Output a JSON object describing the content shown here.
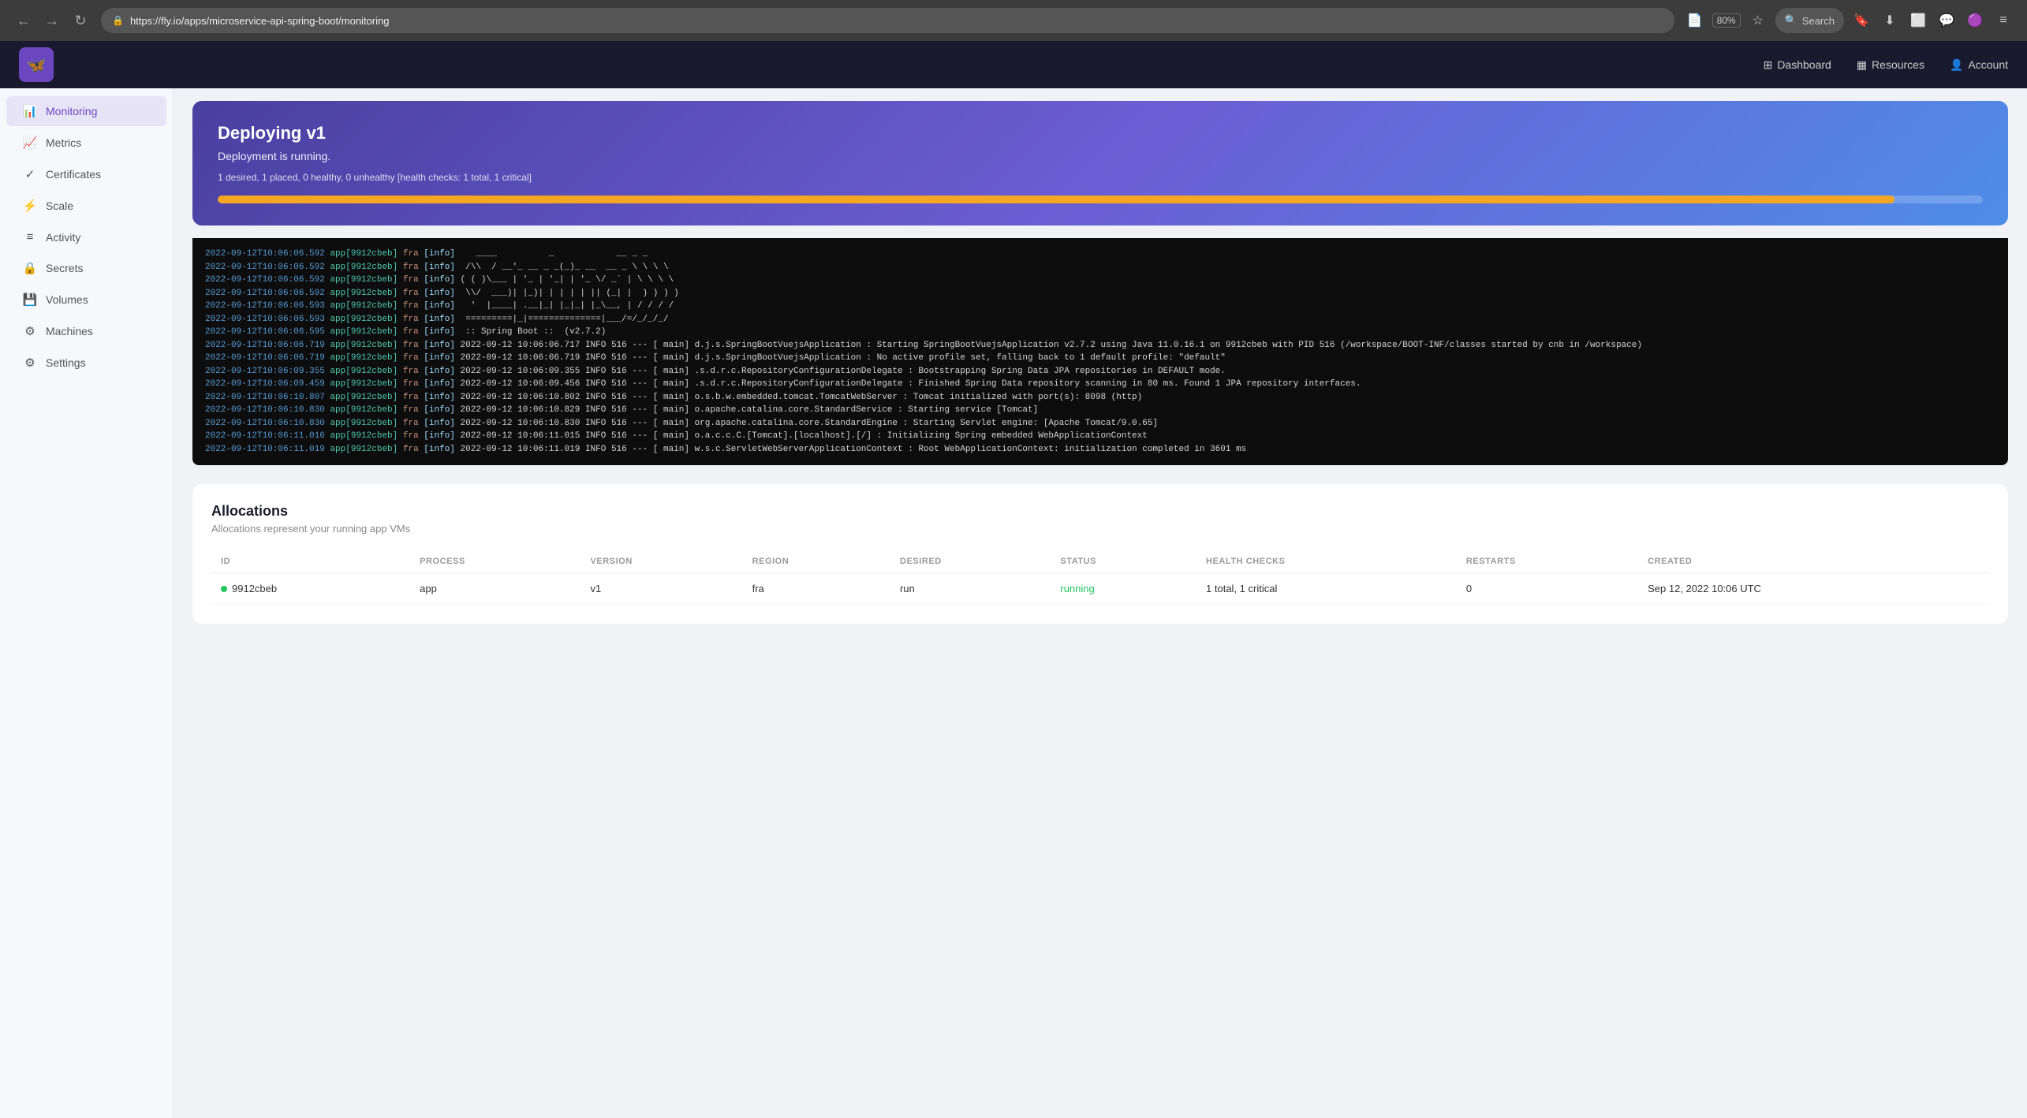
{
  "browser": {
    "url": "https://fly.io/apps/microservice-api-spring-boot/monitoring",
    "zoom": "80%",
    "search_placeholder": "Search"
  },
  "header": {
    "nav": [
      {
        "id": "dashboard",
        "label": "Dashboard",
        "icon": "⊞"
      },
      {
        "id": "resources",
        "label": "Resources",
        "icon": "▦"
      },
      {
        "id": "account",
        "label": "Account",
        "icon": "👤"
      }
    ]
  },
  "sidebar": {
    "items": [
      {
        "id": "monitoring",
        "label": "Monitoring",
        "icon": "📊",
        "active": true
      },
      {
        "id": "metrics",
        "label": "Metrics",
        "icon": "📈"
      },
      {
        "id": "certificates",
        "label": "Certificates",
        "icon": "✓"
      },
      {
        "id": "scale",
        "label": "Scale",
        "icon": "⚡"
      },
      {
        "id": "activity",
        "label": "Activity",
        "icon": "≡"
      },
      {
        "id": "secrets",
        "label": "Secrets",
        "icon": "🔒"
      },
      {
        "id": "volumes",
        "label": "Volumes",
        "icon": "💾"
      },
      {
        "id": "machines",
        "label": "Machines",
        "icon": "⚙"
      },
      {
        "id": "settings",
        "label": "Settings",
        "icon": "⚙"
      }
    ]
  },
  "deployment": {
    "title": "Deploying v1",
    "status": "Deployment is running.",
    "info": "1 desired, 1 placed, 0 healthy, 0 unhealthy [health checks: 1 total, 1 critical]",
    "progress": 95
  },
  "logs": [
    {
      "timestamp": "2022-09-12T10:06:06.592",
      "app": "app[9912cbeb]",
      "region": "fra",
      "level": "[info]",
      "text": "   ____          _            __ _ _"
    },
    {
      "timestamp": "2022-09-12T10:06:06.592",
      "app": "app[9912cbeb]",
      "region": "fra",
      "level": "[info]",
      "text": " /\\\\  / __'_ __ _ _(_)_ __  __ _ \\ \\ \\ \\"
    },
    {
      "timestamp": "2022-09-12T10:06:06.592",
      "app": "app[9912cbeb]",
      "region": "fra",
      "level": "[info]",
      "text": "( ( )\\___ | '_ | '_| | '_ \\/ _` | \\ \\ \\ \\"
    },
    {
      "timestamp": "2022-09-12T10:06:06.592",
      "app": "app[9912cbeb]",
      "region": "fra",
      "level": "[info]",
      "text": " \\\\/  ___)| |_)| | | | | || (_| |  ) ) ) )"
    },
    {
      "timestamp": "2022-09-12T10:06:06.593",
      "app": "app[9912cbeb]",
      "region": "fra",
      "level": "[info]",
      "text": "  '  |____| .__|_| |_|_| |_\\__, | / / / /"
    },
    {
      "timestamp": "2022-09-12T10:06:06.593",
      "app": "app[9912cbeb]",
      "region": "fra",
      "level": "[info]",
      "text": " =========|_|==============|___/=/_/_/_/"
    },
    {
      "timestamp": "2022-09-12T10:06:06.595",
      "app": "app[9912cbeb]",
      "region": "fra",
      "level": "[info]",
      "text": " :: Spring Boot ::  (v2.7.2)"
    },
    {
      "timestamp": "2022-09-12T10:06:06.719",
      "app": "app[9912cbeb]",
      "region": "fra",
      "level": "[info]",
      "text": "2022-09-12 10:06:06.717 INFO 516 --- [ main] d.j.s.SpringBootVuejsApplication : Starting SpringBootVuejsApplication v2.7.2 using Java 11.0.16.1 on 9912cbeb with PID 516 (/workspace/BOOT-INF/classes started by cnb in /workspace)"
    },
    {
      "timestamp": "2022-09-12T10:06:06.719",
      "app": "app[9912cbeb]",
      "region": "fra",
      "level": "[info]",
      "text": "2022-09-12 10:06:06.719 INFO 516 --- [ main] d.j.s.SpringBootVuejsApplication : No active profile set, falling back to 1 default profile: \"default\""
    },
    {
      "timestamp": "2022-09-12T10:06:09.355",
      "app": "app[9912cbeb]",
      "region": "fra",
      "level": "[info]",
      "text": "2022-09-12 10:06:09.355 INFO 516 --- [ main] .s.d.r.c.RepositoryConfigurationDelegate : Bootstrapping Spring Data JPA repositories in DEFAULT mode."
    },
    {
      "timestamp": "2022-09-12T10:06:09.459",
      "app": "app[9912cbeb]",
      "region": "fra",
      "level": "[info]",
      "text": "2022-09-12 10:06:09.456 INFO 516 --- [ main] .s.d.r.c.RepositoryConfigurationDelegate : Finished Spring Data repository scanning in 80 ms. Found 1 JPA repository interfaces."
    },
    {
      "timestamp": "2022-09-12T10:06:10.807",
      "app": "app[9912cbeb]",
      "region": "fra",
      "level": "[info]",
      "text": "2022-09-12 10:06:10.802 INFO 516 --- [ main] o.s.b.w.embedded.tomcat.TomcatWebServer : Tomcat initialized with port(s): 8098 (http)"
    },
    {
      "timestamp": "2022-09-12T10:06:10.830",
      "app": "app[9912cbeb]",
      "region": "fra",
      "level": "[info]",
      "text": "2022-09-12 10:06:10.829 INFO 516 --- [ main] o.apache.catalina.core.StandardService : Starting service [Tomcat]"
    },
    {
      "timestamp": "2022-09-12T10:06:10.830",
      "app": "app[9912cbeb]",
      "region": "fra",
      "level": "[info]",
      "text": "2022-09-12 10:06:10.830 INFO 516 --- [ main] org.apache.catalina.core.StandardEngine : Starting Servlet engine: [Apache Tomcat/9.0.65]"
    },
    {
      "timestamp": "2022-09-12T10:06:11.016",
      "app": "app[9912cbeb]",
      "region": "fra",
      "level": "[info]",
      "text": "2022-09-12 10:06:11.015 INFO 516 --- [ main] o.a.c.c.C.[Tomcat].[localhost].[/] : Initializing Spring embedded WebApplicationContext"
    },
    {
      "timestamp": "2022-09-12T10:06:11.019",
      "app": "app[9912cbeb]",
      "region": "fra",
      "level": "[info]",
      "text": "2022-09-12 10:06:11.019 INFO 516 --- [ main] w.s.c.ServletWebServerApplicationContext : Root WebApplicationContext: initialization completed in 3601 ms"
    }
  ],
  "allocations": {
    "title": "Allocations",
    "description": "Allocations represent your running app VMs",
    "columns": [
      "ID",
      "PROCESS",
      "VERSION",
      "REGION",
      "DESIRED",
      "STATUS",
      "HEALTH CHECKS",
      "RESTARTS",
      "CREATED"
    ],
    "rows": [
      {
        "id": "9912cbeb",
        "process": "app",
        "version": "v1",
        "region": "fra",
        "desired": "run",
        "status": "running",
        "health_checks": "1 total, 1 critical",
        "restarts": "0",
        "created": "Sep 12, 2022 10:06 UTC",
        "status_color": "green"
      }
    ]
  }
}
